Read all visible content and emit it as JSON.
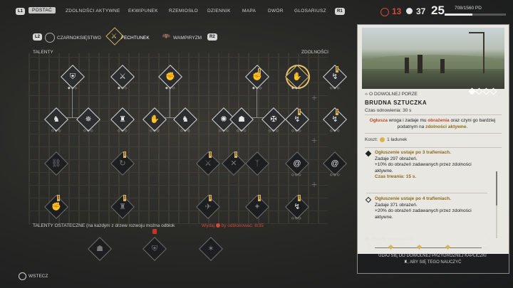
{
  "nav": {
    "left_key": "L1",
    "right_key": "R1",
    "tabs": [
      "POSTAĆ",
      "ZDOLNOŚCI AKTYWNE",
      "EKWIPUNEK",
      "RZEMIOSŁO",
      "DZIENNIK",
      "MAPA",
      "DWÓR",
      "GLOSARIUSZ"
    ]
  },
  "stats": {
    "red_value": "13",
    "white_value": "37",
    "level": "25",
    "xp": "708/1560 PD",
    "xp_fraction": 0.454,
    "red_color": "#d24a3a"
  },
  "trees": {
    "tree1": "CZARNOKSIĘSTWO",
    "tree2": "FECHTUNEK",
    "tree3": "WAMPIRYZM"
  },
  "sections": {
    "talents": "TALENTY",
    "abilities": "ZDOLNOŚCI"
  },
  "ultimate": {
    "label": "TALENTY OSTATECZNE (na każdym z drzew rozwoju można odblok",
    "lock_text": "Wydaj",
    "lock_rest": "by odblokować: 8/35"
  },
  "footer": {
    "back": "WSTECZ"
  },
  "panel": {
    "tag": "O DOWOLNEJ PORZE",
    "title": "BRUDNA SZTUCZKA",
    "cooldown": "Czas odnowienia: 30 s",
    "desc_1": "Ogłusza",
    "desc_2": " wroga i zadaje mu ",
    "desc_3": "obrażenia",
    "desc_4": " oraz czyni go bardziej podatnym na ",
    "desc_5": "zdolności aktywne",
    "desc_6": ".",
    "cost_label": "Koszt:",
    "cost_value": "1 ładunek",
    "level1": [
      "Ogłuszenie ustaje po 3 trafieniach.",
      "Zadaje 297 obrażeń.",
      "+10% do obrażeń zadawanych przez zdolności aktywne.",
      "Czas trwania: 15 s."
    ],
    "level2": [
      "Ogłuszenie ustaje po 4 trafieniach.",
      "Zadaje 371 obrażeń.",
      "+20% do obrażeń zadawanych przez zdolności aktywne."
    ],
    "points_label": "Punkty umiejętności",
    "points_value": "1",
    "hint1": "UDAJ SIĘ DO DOWOLNEJ PRZYDROŻNEJ KAPLICZKI",
    "hint2": ", ABY SIĘ TEGO NAUCZYĆ"
  }
}
